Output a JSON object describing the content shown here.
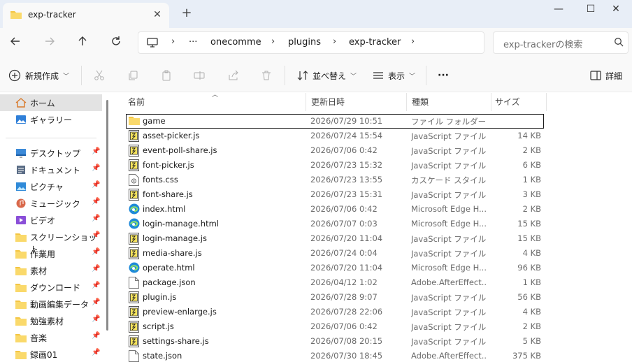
{
  "tab": {
    "title": "exp-tracker"
  },
  "window": {
    "minimize": "—",
    "maximize": "☐",
    "close": "✕"
  },
  "breadcrumb": {
    "ellipsis": "···",
    "items": [
      "onecomme",
      "plugins",
      "exp-tracker"
    ]
  },
  "search": {
    "placeholder": "exp-trackerの検索"
  },
  "commands": {
    "new": "新規作成",
    "sort": "並べ替え",
    "view": "表示",
    "more": "···",
    "details": "詳細"
  },
  "sidebar": {
    "top": [
      {
        "label": "ホーム",
        "icon": "home-icon",
        "selected": true
      },
      {
        "label": "ギャラリー",
        "icon": "gallery-icon",
        "selected": false
      }
    ],
    "pinned": [
      {
        "label": "デスクトップ",
        "icon": "desktop-icon"
      },
      {
        "label": "ドキュメント",
        "icon": "documents-icon"
      },
      {
        "label": "ピクチャ",
        "icon": "pictures-icon"
      },
      {
        "label": "ミュージック",
        "icon": "music-icon"
      },
      {
        "label": "ビデオ",
        "icon": "videos-icon"
      },
      {
        "label": "スクリーンショット",
        "icon": "folder-icon"
      },
      {
        "label": "作業用",
        "icon": "folder-icon"
      },
      {
        "label": "素材",
        "icon": "folder-icon"
      },
      {
        "label": "ダウンロード",
        "icon": "folder-icon"
      },
      {
        "label": "動画編集データ",
        "icon": "folder-icon"
      },
      {
        "label": "勉強素材",
        "icon": "folder-icon"
      },
      {
        "label": "音楽",
        "icon": "folder-icon"
      },
      {
        "label": "録画01",
        "icon": "folder-icon"
      }
    ]
  },
  "columns": {
    "name": "名前",
    "date": "更新日時",
    "type": "種類",
    "size": "サイズ"
  },
  "files": [
    {
      "name": "game",
      "date": "2026/07/29 10:51",
      "type": "ファイル フォルダー",
      "size": "",
      "icon": "folder"
    },
    {
      "name": "asset-picker.js",
      "date": "2026/07/24 15:54",
      "type": "JavaScript ファイル",
      "size": "14 KB",
      "icon": "js"
    },
    {
      "name": "event-poll-share.js",
      "date": "2026/07/06 0:42",
      "type": "JavaScript ファイル",
      "size": "2 KB",
      "icon": "js"
    },
    {
      "name": "font-picker.js",
      "date": "2026/07/23 15:32",
      "type": "JavaScript ファイル",
      "size": "6 KB",
      "icon": "js"
    },
    {
      "name": "fonts.css",
      "date": "2026/07/23 13:55",
      "type": "カスケード スタイル シ...",
      "size": "1 KB",
      "icon": "css"
    },
    {
      "name": "font-share.js",
      "date": "2026/07/23 15:31",
      "type": "JavaScript ファイル",
      "size": "3 KB",
      "icon": "js"
    },
    {
      "name": "index.html",
      "date": "2026/07/06 0:42",
      "type": "Microsoft Edge H...",
      "size": "2 KB",
      "icon": "html"
    },
    {
      "name": "login-manage.html",
      "date": "2026/07/07 0:03",
      "type": "Microsoft Edge H...",
      "size": "15 KB",
      "icon": "html"
    },
    {
      "name": "login-manage.js",
      "date": "2026/07/20 11:04",
      "type": "JavaScript ファイル",
      "size": "15 KB",
      "icon": "js"
    },
    {
      "name": "media-share.js",
      "date": "2026/07/24 0:04",
      "type": "JavaScript ファイル",
      "size": "4 KB",
      "icon": "js"
    },
    {
      "name": "operate.html",
      "date": "2026/07/20 11:04",
      "type": "Microsoft Edge H...",
      "size": "96 KB",
      "icon": "html"
    },
    {
      "name": "package.json",
      "date": "2026/04/12 1:02",
      "type": "Adobe.AfterEffect...",
      "size": "1 KB",
      "icon": "json"
    },
    {
      "name": "plugin.js",
      "date": "2026/07/28 9:07",
      "type": "JavaScript ファイル",
      "size": "56 KB",
      "icon": "js"
    },
    {
      "name": "preview-enlarge.js",
      "date": "2026/07/28 22:06",
      "type": "JavaScript ファイル",
      "size": "4 KB",
      "icon": "js"
    },
    {
      "name": "script.js",
      "date": "2026/07/06 0:42",
      "type": "JavaScript ファイル",
      "size": "2 KB",
      "icon": "js"
    },
    {
      "name": "settings-share.js",
      "date": "2026/07/08 20:15",
      "type": "JavaScript ファイル",
      "size": "5 KB",
      "icon": "js"
    },
    {
      "name": "state.json",
      "date": "2026/07/30 18:45",
      "type": "Adobe.AfterEffect...",
      "size": "375 KB",
      "icon": "json"
    }
  ],
  "colors": {
    "folder": "#f4c542",
    "accent": "#0067c0",
    "edge": "#1f8ad8"
  }
}
